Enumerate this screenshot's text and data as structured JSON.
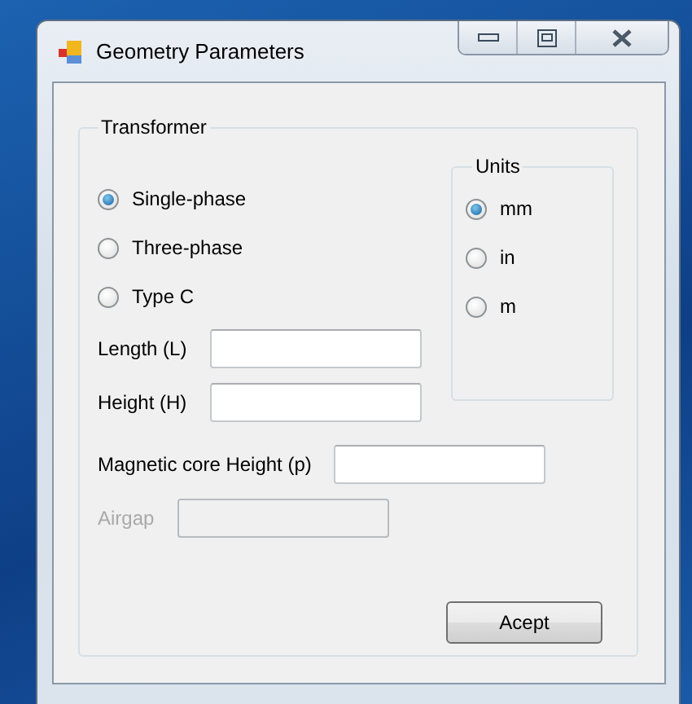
{
  "window": {
    "title": "Geometry Parameters"
  },
  "transformer": {
    "title": "Transformer",
    "types": [
      {
        "label": "Single-phase",
        "selected": true
      },
      {
        "label": "Three-phase",
        "selected": false
      },
      {
        "label": "Type C",
        "selected": false
      }
    ],
    "units": {
      "title": "Units",
      "options": [
        {
          "label": "mm",
          "selected": true
        },
        {
          "label": "in",
          "selected": false
        },
        {
          "label": "m",
          "selected": false
        }
      ]
    },
    "fields": [
      {
        "label": "Length (L)",
        "disabled": false
      },
      {
        "label": "Height (H)",
        "disabled": false
      },
      {
        "label": "Magnetic core Height (p)",
        "disabled": false
      },
      {
        "label": "Airgap",
        "disabled": true
      }
    ],
    "button": "Acept"
  }
}
